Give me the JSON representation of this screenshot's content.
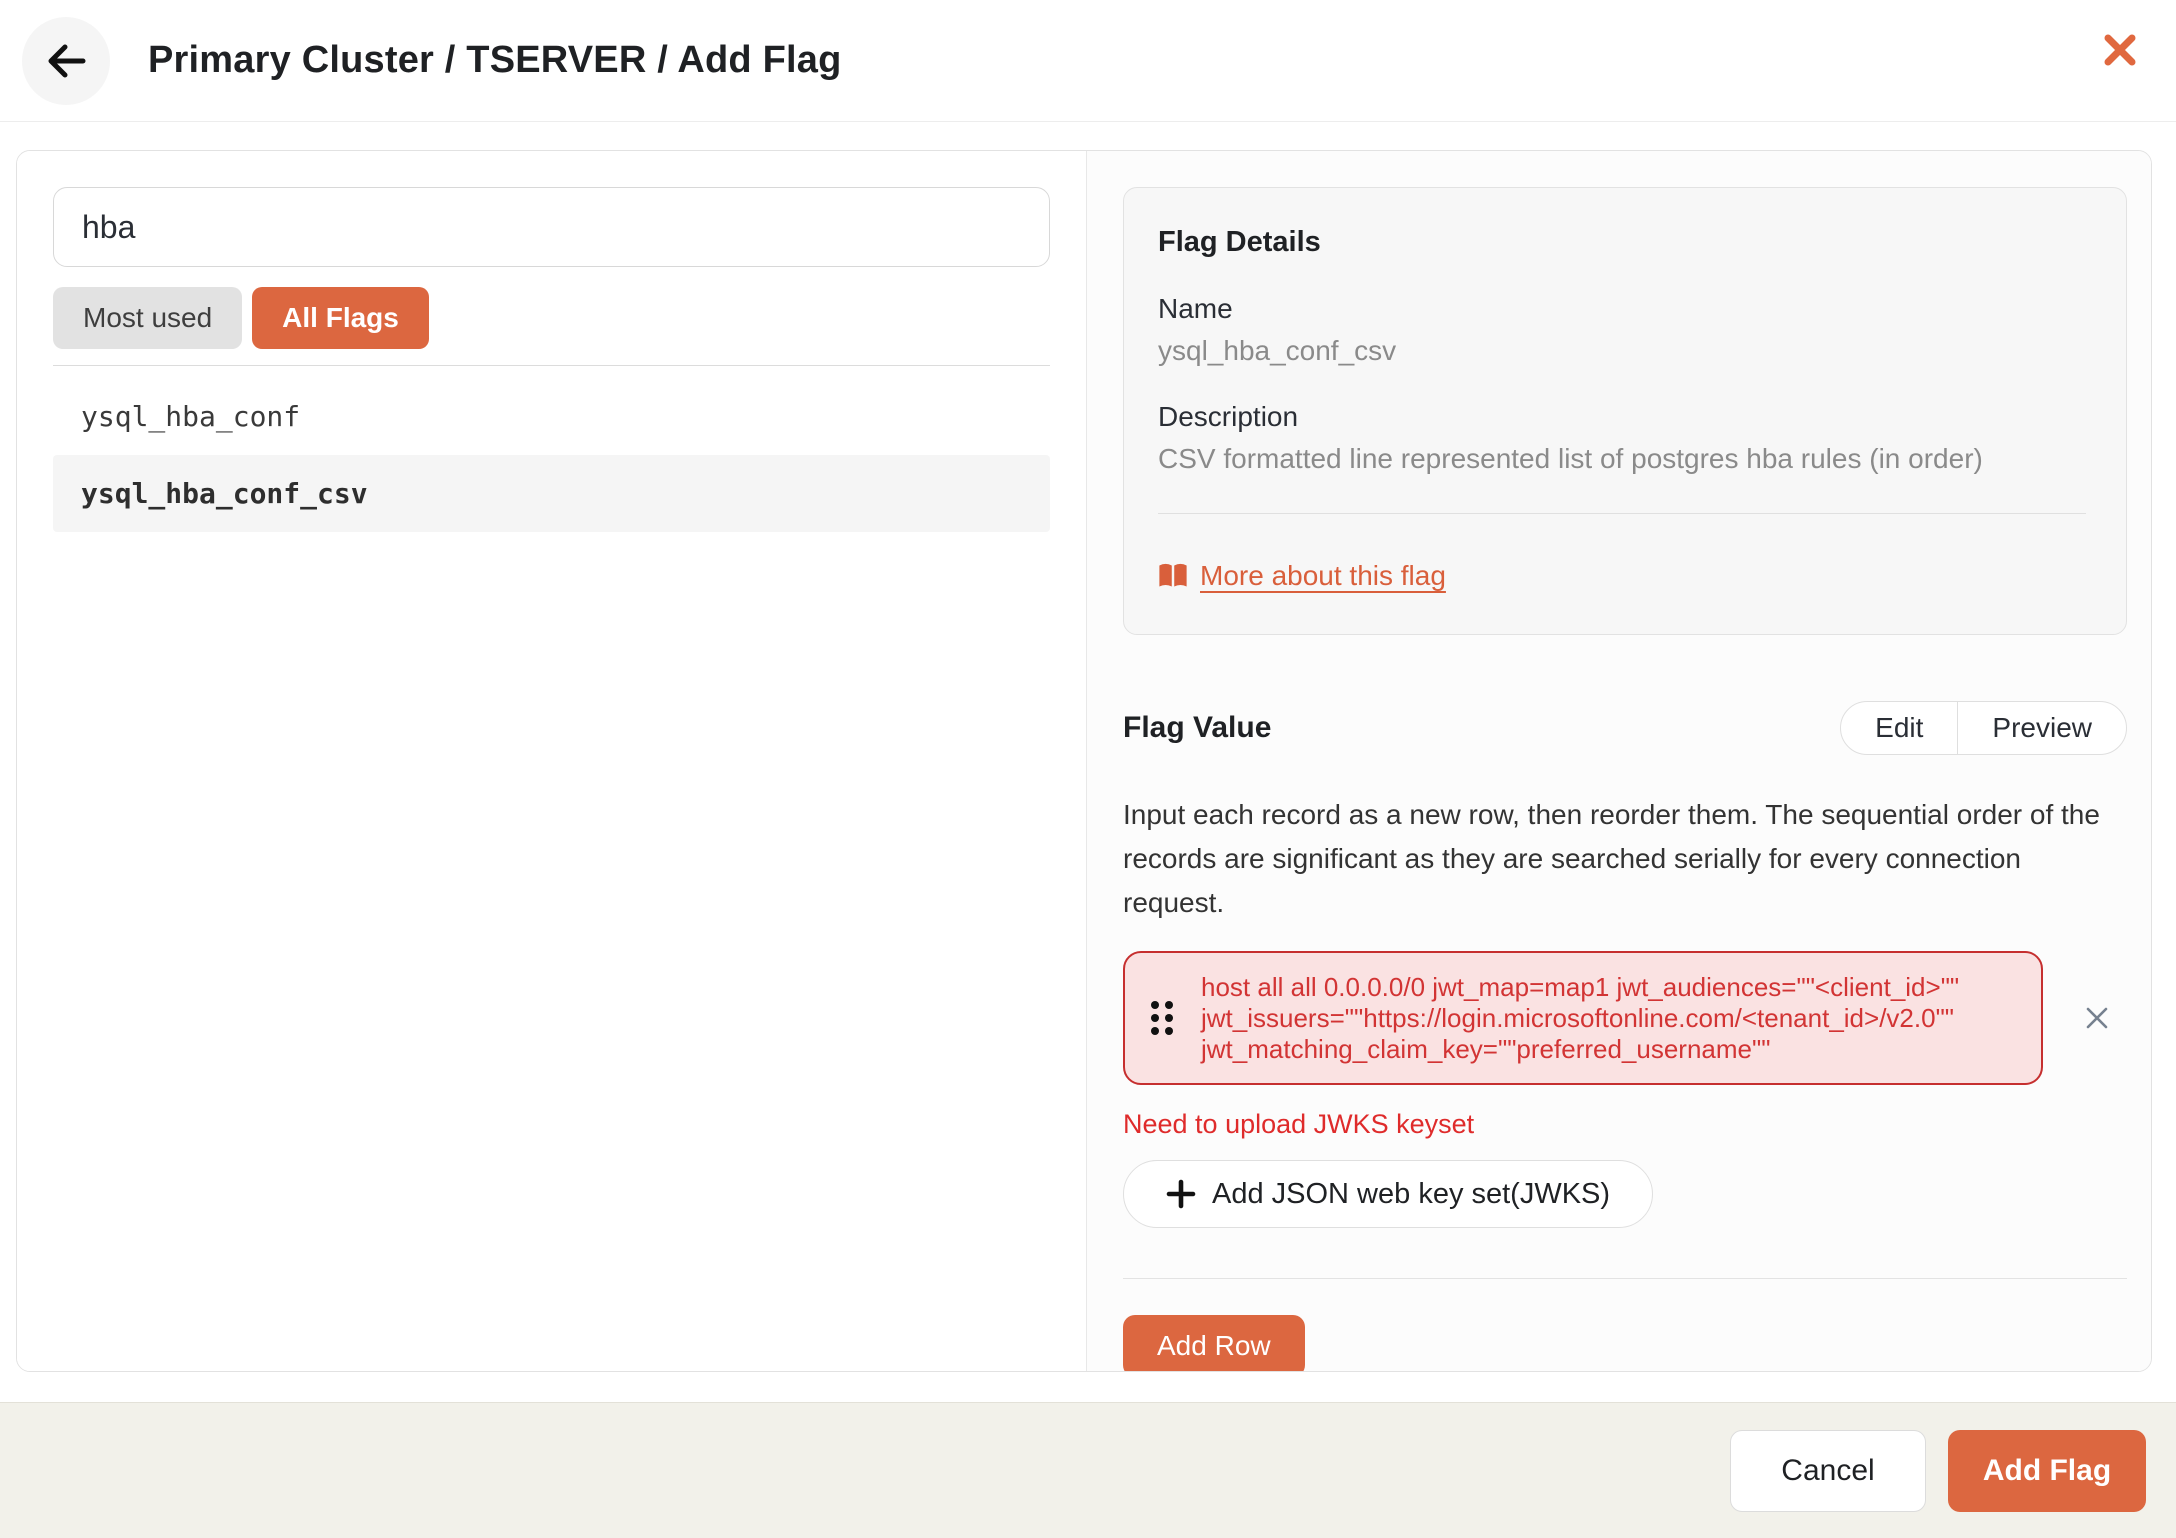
{
  "header": {
    "title": "Primary Cluster / TSERVER / Add Flag"
  },
  "left_panel": {
    "search": {
      "value": "hba"
    },
    "filters": [
      {
        "label": "Most used",
        "active": false
      },
      {
        "label": "All Flags",
        "active": true
      }
    ],
    "flags": [
      {
        "name": "ysql_hba_conf",
        "selected": false
      },
      {
        "name": "ysql_hba_conf_csv",
        "selected": true
      }
    ]
  },
  "flag_details": {
    "heading": "Flag Details",
    "name_label": "Name",
    "name_value": "ysql_hba_conf_csv",
    "description_label": "Description",
    "description_value": "CSV formatted line represented list of postgres hba rules (in order)",
    "more_link_label": "More about this flag"
  },
  "flag_value": {
    "heading": "Flag Value",
    "toggle": {
      "edit_label": "Edit",
      "preview_label": "Preview"
    },
    "help_text": "Input each record as a new row, then reorder them. The sequential order of the records are significant as they are searched serially for every connection request.",
    "row_value": "host all all 0.0.0.0/0 jwt_map=map1 jwt_audiences=\"\"<client_id>\"\" jwt_issuers=\"\"https://login.microsoftonline.com/<tenant_id>/v2.0\"\" jwt_matching_claim_key=\"\"preferred_username\"\"",
    "error_text": "Need to upload JWKS keyset",
    "jwks_button_label": "Add JSON web key set(JWKS)",
    "add_row_label": "Add Row"
  },
  "footer": {
    "cancel_label": "Cancel",
    "add_flag_label": "Add Flag"
  },
  "icons": {
    "back": "back-arrow-icon",
    "close": "close-icon",
    "book": "book-icon",
    "drag": "drag-handle-icon",
    "plus": "plus-icon",
    "remove": "remove-icon"
  },
  "colors": {
    "accent_orange": "#dc6740",
    "danger_red": "#d32f2f",
    "danger_row_bg": "#fae2e2",
    "danger_row_border": "#c62f2f",
    "footer_bg": "#f2f1ea",
    "details_box_bg": "#f7f7f7",
    "selected_row_bg": "#f5f5f5"
  }
}
